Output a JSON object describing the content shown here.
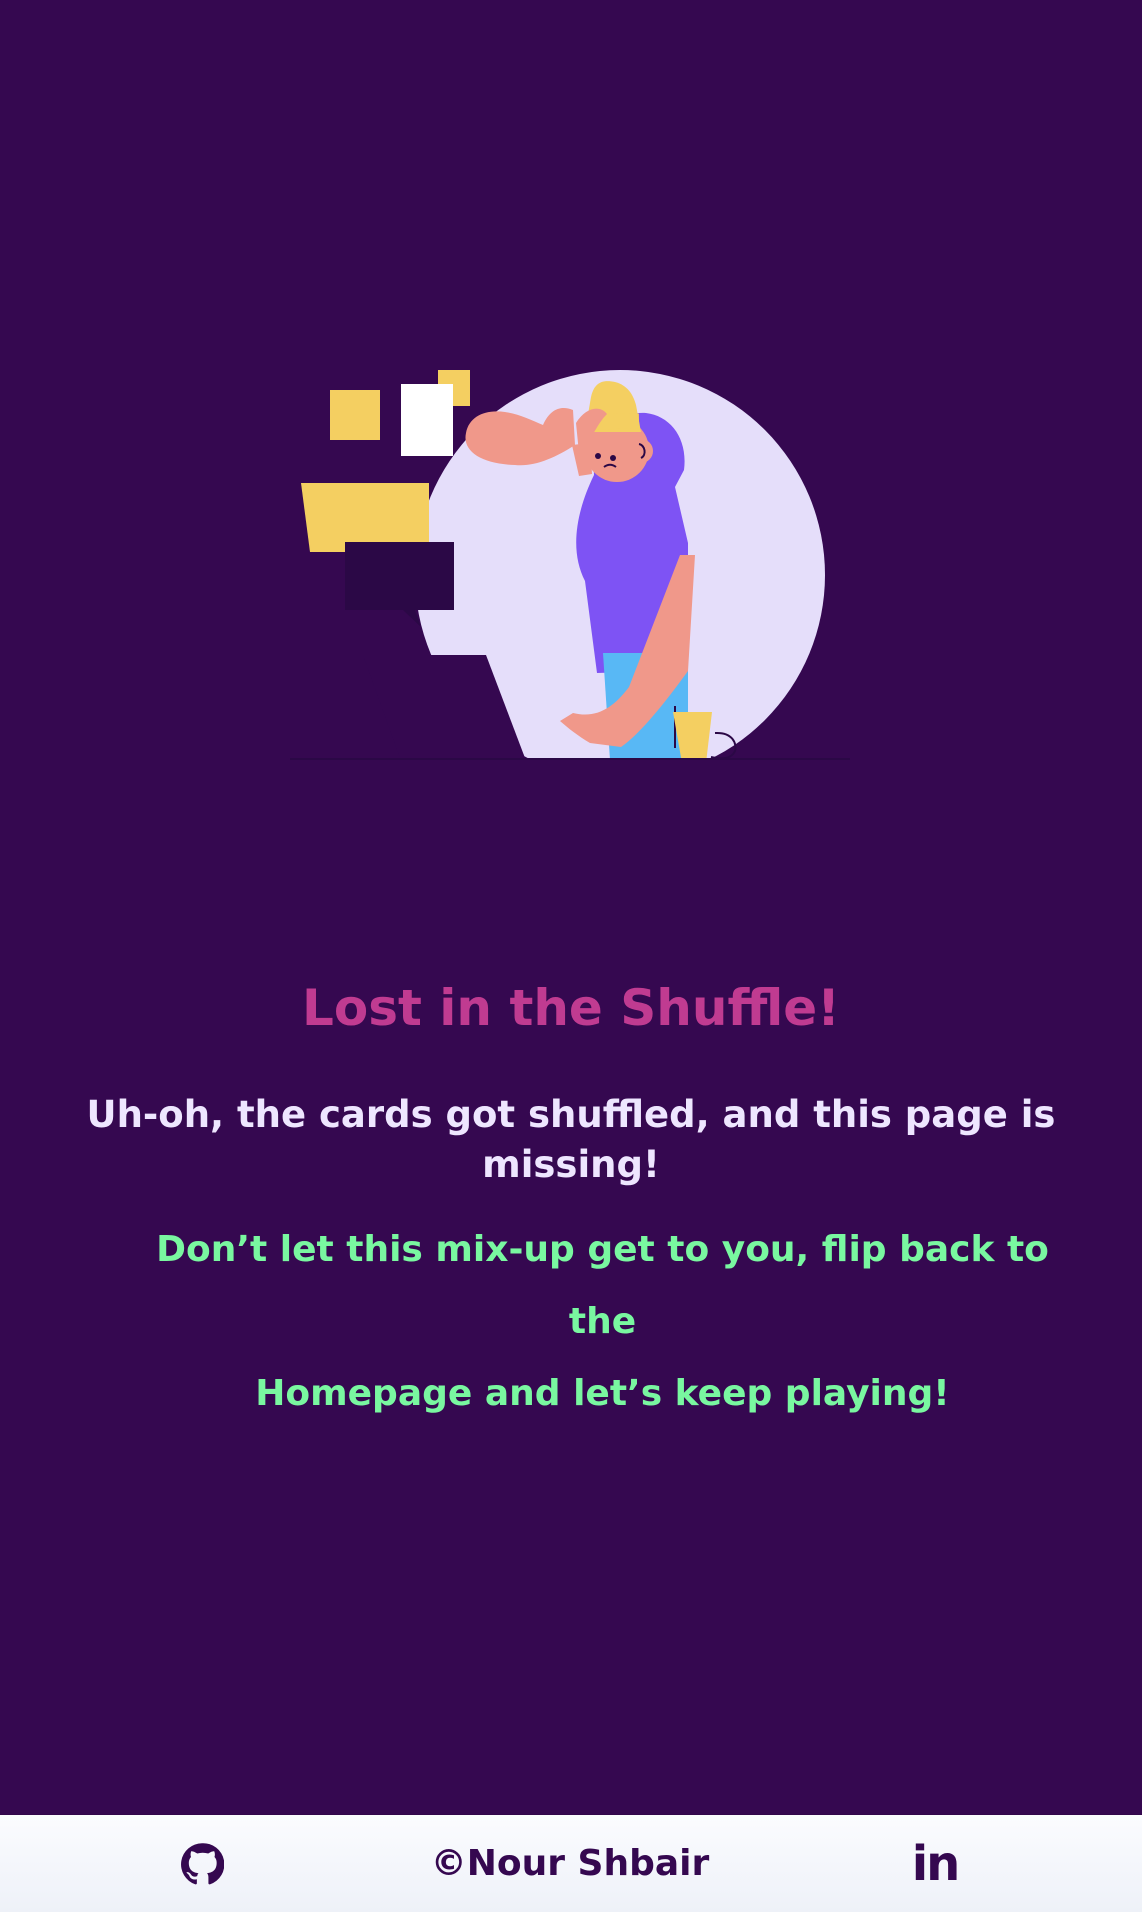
{
  "colors": {
    "background": "#350850",
    "title": "#c03b91",
    "subtitle": "#eee6ff",
    "message": "#79f7a0",
    "footer": "#f7f9fd",
    "footer_text": "#350850"
  },
  "hero": {
    "title": "Lost in the Shuffle!",
    "subtitle": "Uh-oh, the cards got shuffled, and this page is missing!",
    "message_prefix": "Don’t let this mix-up get to you, flip back to the",
    "homepage_link": "Homepage",
    "message_suffix": "and let’s keep playing!"
  },
  "footer": {
    "copyright": "©Nour Shbair",
    "github_icon": "github-icon",
    "linkedin_icon": "linkedin-icon",
    "linkedin_text": "in"
  }
}
